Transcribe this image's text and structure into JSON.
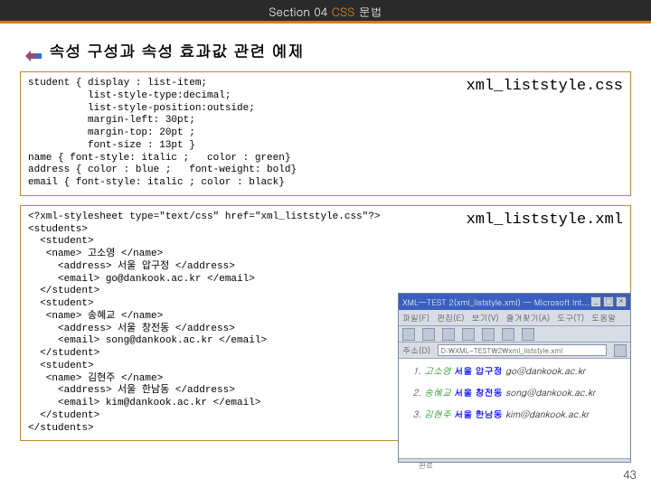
{
  "section_bar": "Section 04 CSS 문법",
  "heading": "속성 구성과 속성 효과값 관련 예제",
  "box1": {
    "file": "xml_liststyle.css",
    "code": "student { display : list-item;\n          list-style-type:decimal;\n          list-style-position:outside;\n          margin-left: 30pt;\n          margin-top: 20pt ;\n          font-size : 13pt }\nname { font-style: italic ;   color : green}\naddress { color : blue ;   font-weight: bold}\nemail { font-style: italic ; color : black}"
  },
  "box2": {
    "file": "xml_liststyle.xml",
    "code": "<?xml-stylesheet type=\"text/css\" href=\"xml_liststyle.css\"?>\n<students>\n  <student>\n   <name> 고소영 </name>\n     <address> 서울 압구정 </address>\n     <email> go@dankook.ac.kr </email>\n  </student>\n  <student>\n   <name> 송혜교 </name>\n     <address> 서울 창전동 </address>\n     <email> song@dankook.ac.kr </email>\n  </student>\n  <student>\n   <name> 김현주 </name>\n     <address> 서울 한남동 </address>\n     <email> kim@dankook.ac.kr </email>\n  </student>\n</students>"
  },
  "browser": {
    "title": "XML—TEST 2(xml_liststyle.xml) — Microsoft Int...",
    "menu": [
      "파일(F)",
      "편집(E)",
      "보기(V)",
      "즐겨찾기(A)",
      "도구(T)",
      "도움말"
    ],
    "addr_label": "주소(D)",
    "addr_value": "D:\\XML-TEST\\2\\xml_liststyle.xml",
    "items": [
      {
        "name": "고소영",
        "address": "서울 압구정",
        "email": "go@dankook.ac.kr"
      },
      {
        "name": "송혜교",
        "address": "서울 창전동",
        "email": "song@dankook.ac.kr"
      },
      {
        "name": "김현주",
        "address": "서울 한남동",
        "email": "kim@dankook.ac.kr"
      }
    ],
    "status": "완료"
  },
  "page_number": "43"
}
